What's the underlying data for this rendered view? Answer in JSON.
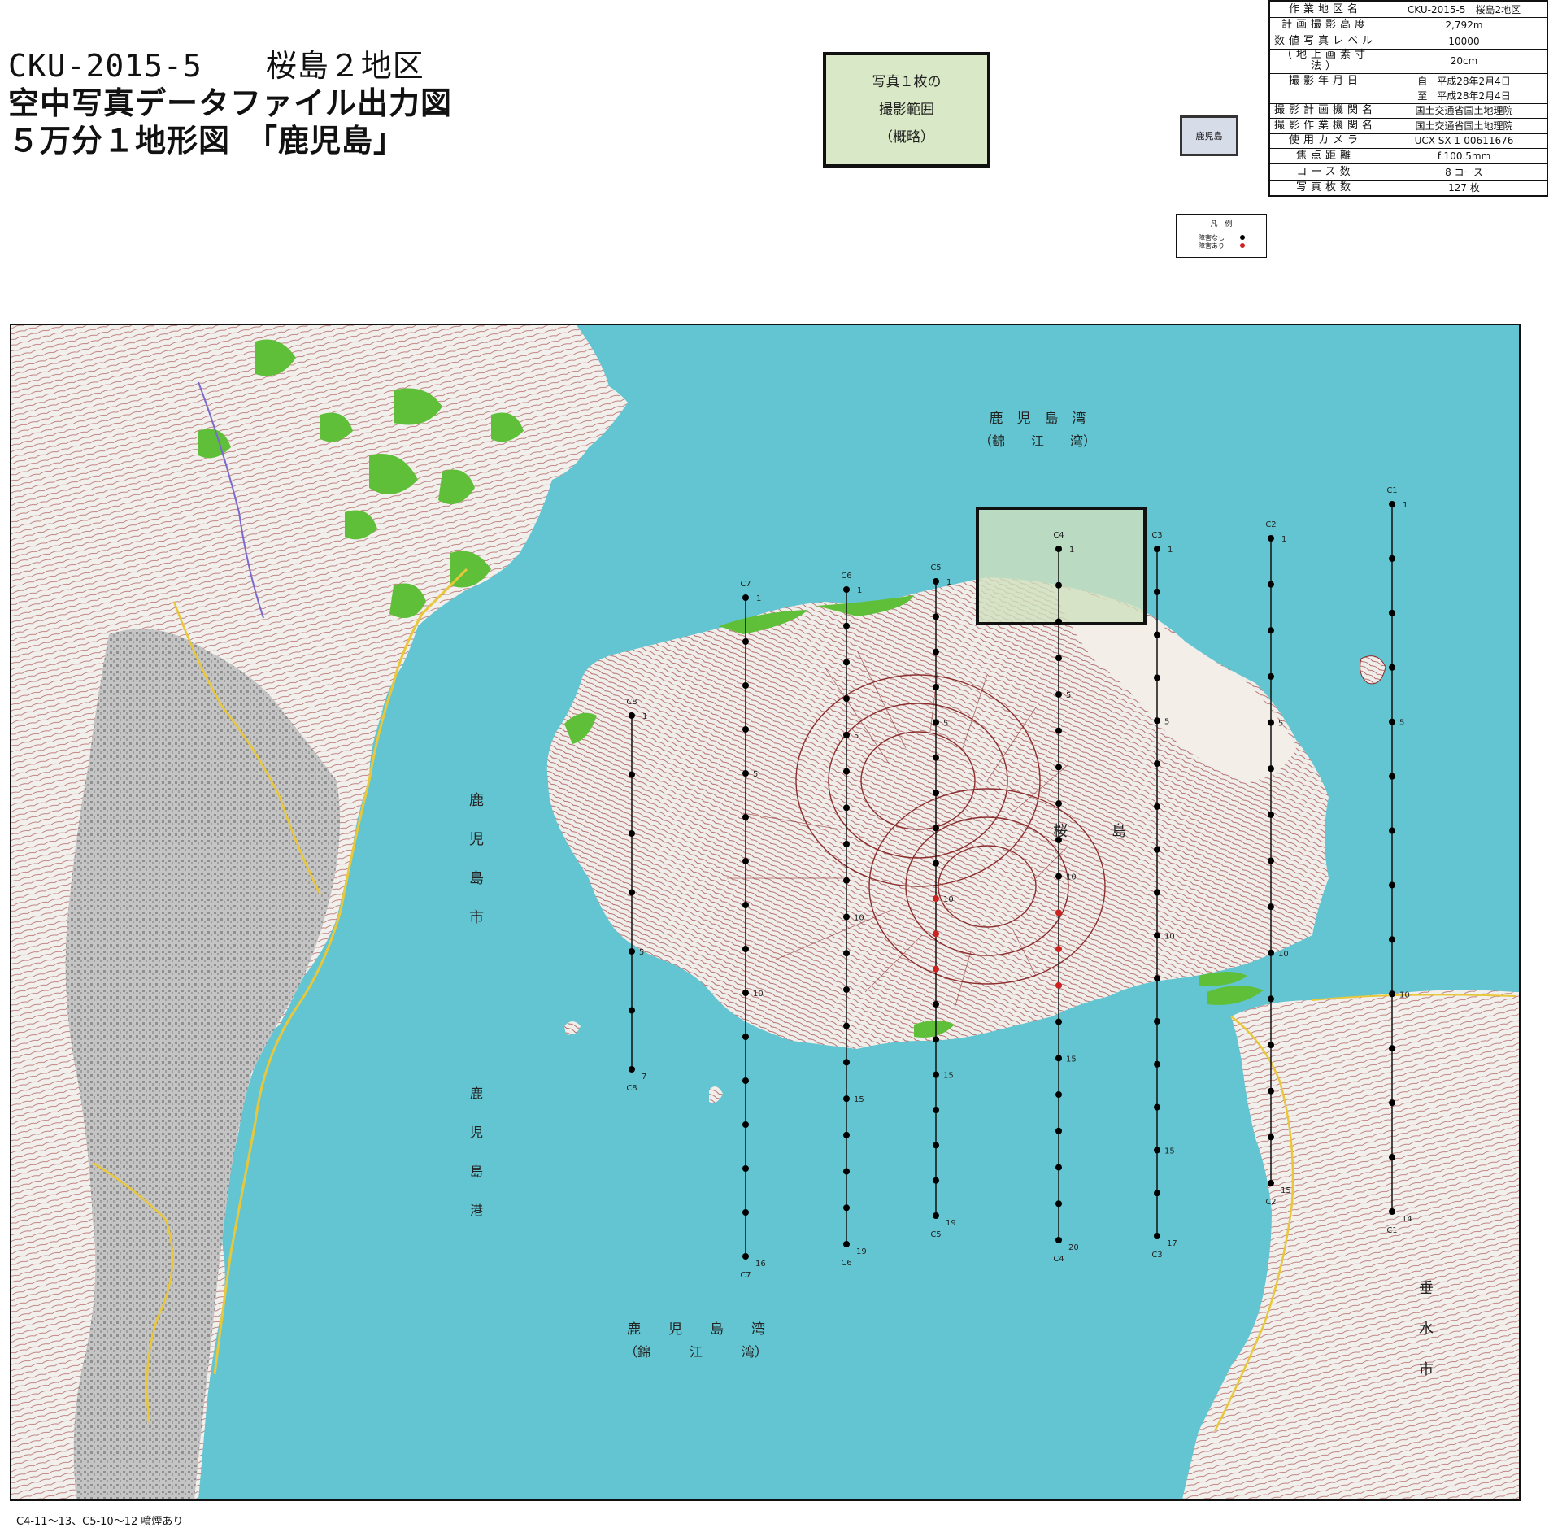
{
  "header": {
    "line1": "CKU-2015-5　　桜島２地区",
    "line2": "空中写真データファイル出力図",
    "line3": "５万分１地形図　「鹿児島」"
  },
  "footprint": {
    "line1": "写真１枚の",
    "line2": "撮影範囲",
    "line3": "（概略）"
  },
  "keymap_label": "鹿児島",
  "metadata": [
    {
      "key": "作業地区名",
      "value": "CKU-2015-5　桜島2地区"
    },
    {
      "key": "計画撮影高度",
      "value": "2,792m"
    },
    {
      "key": "数値写真レベル",
      "value": "10000"
    },
    {
      "key": "（地上画素寸法）",
      "value": "20cm"
    },
    {
      "key": "撮影年月日",
      "value": "自　平成28年2月4日"
    },
    {
      "key": "",
      "value": "至　平成28年2月4日"
    },
    {
      "key": "撮影計画機関名",
      "value": "国土交通省国土地理院"
    },
    {
      "key": "撮影作業機関名",
      "value": "国土交通省国土地理院"
    },
    {
      "key": "使用カメラ",
      "value": "UCX-SX-1-00611676"
    },
    {
      "key": "焦点距離",
      "value": "f:100.5mm"
    },
    {
      "key": "コース数",
      "value": "8 コース"
    },
    {
      "key": "写真枚数",
      "value": "127 枚"
    }
  ],
  "legend": {
    "title": "凡　例",
    "no_obstruction": "障害なし",
    "obstruction": "障害あり",
    "color_no": "#000000",
    "color_yes": "#cc2222"
  },
  "map": {
    "bay_labels": [
      {
        "main": "鹿　児　島　湾",
        "sub": "（錦　　江　　湾）"
      },
      {
        "main": "鹿　　児　　島　　湾",
        "sub": "（錦　　　江　　　湾）"
      }
    ],
    "city_kagoshima": [
      "鹿",
      "児",
      "島",
      "市"
    ],
    "port_kagoshima": [
      "鹿",
      "児",
      "島",
      "港"
    ],
    "city_tarumizu": [
      "垂",
      "水",
      "市"
    ],
    "island_label": [
      "桜",
      "島"
    ],
    "colors": {
      "sea": "#63c5d1",
      "land": "#f2f0ec",
      "urban": "#b9b9b9",
      "forest": "#63bf3d",
      "contour": "#9a3e3e",
      "footprint_fill": "#cfe0bd"
    },
    "courses": [
      {
        "id": "C1",
        "first": "1",
        "last": "14",
        "marks": [
          "5",
          "10"
        ]
      },
      {
        "id": "C2",
        "first": "1",
        "last": "15",
        "marks": [
          "5",
          "10"
        ]
      },
      {
        "id": "C3",
        "first": "1",
        "last": "17",
        "marks": [
          "5",
          "10",
          "15"
        ]
      },
      {
        "id": "C4",
        "first": "1",
        "last": "20",
        "marks": [
          "5",
          "10",
          "15"
        ]
      },
      {
        "id": "C5",
        "first": "1",
        "last": "19",
        "marks": [
          "5",
          "10",
          "15"
        ]
      },
      {
        "id": "C6",
        "first": "1",
        "last": "19",
        "marks": [
          "5",
          "10",
          "15"
        ]
      },
      {
        "id": "C7",
        "first": "1",
        "last": "16",
        "marks": [
          "5",
          "10"
        ]
      },
      {
        "id": "C8",
        "first": "1",
        "last": "7",
        "marks": [
          "5"
        ]
      }
    ]
  },
  "footnote": "C4-11～13、C5-10～12 噴煙あり"
}
